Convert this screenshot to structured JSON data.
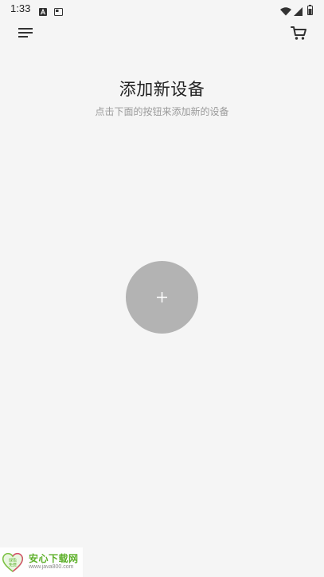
{
  "status_bar": {
    "time": "1:33",
    "left_icons": [
      "accessibility-a-icon",
      "screenshot-icon"
    ],
    "right_icons": [
      "wifi-icon",
      "cell-signal-icon",
      "battery-icon"
    ]
  },
  "app_bar": {
    "menu_icon": "menu-icon",
    "cart_icon": "shopping-cart-icon"
  },
  "main": {
    "title": "添加新设备",
    "subtitle": "点击下面的按钮来添加新的设备",
    "add_button_symbol": "+"
  },
  "watermark": {
    "name": "安心下载网",
    "url": "www.java800.com",
    "badge_text": [
      "绿色",
      "免费"
    ]
  },
  "colors": {
    "background": "#f5f5f5",
    "add_button": "#b3b3b3",
    "subtitle": "#9a9a9a",
    "watermark_green": "#5db02a"
  }
}
